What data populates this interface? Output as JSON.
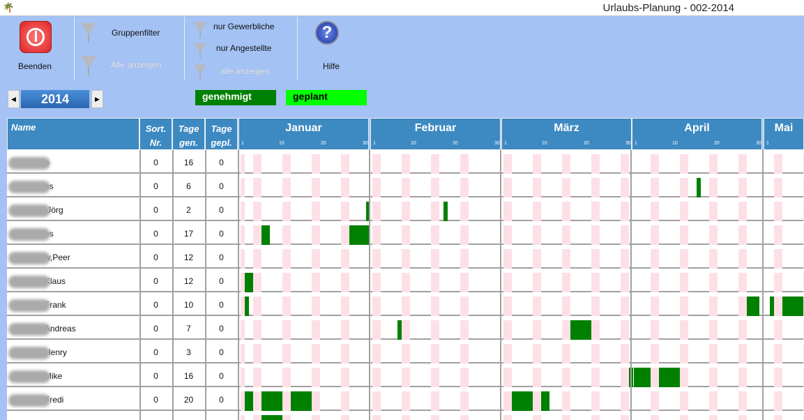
{
  "window": {
    "title": "Urlaubs-Planung - 002-2014"
  },
  "toolbar": {
    "quit": "Beenden",
    "group_filter": "Gruppenfilter",
    "show_all": "Alle anzeigen",
    "only_commercial": "nur Gewerbliche",
    "only_employees": "nur Angestellte",
    "show_all2": "alle anzeigen",
    "help": "Hilfe"
  },
  "year": "2014",
  "legend": {
    "approved": "genehmigt",
    "planned": "geplant",
    "approved_color": "#008000",
    "planned_color": "#00ff00"
  },
  "headers": {
    "name": "Name",
    "sort1": "Sort.",
    "sort2": "Nr.",
    "gen1": "Tage",
    "gen2": "gen.",
    "gepl1": "Tage",
    "gepl2": "gepl."
  },
  "months": [
    "Januar",
    "Februar",
    "März",
    "April",
    "Mai"
  ],
  "ticks": [
    "1",
    "10",
    "20",
    "30"
  ],
  "colors": {
    "weekend": "#fde0e6",
    "header": "#3d89c2",
    "approved": "#008000"
  },
  "rows": [
    {
      "name": "o",
      "sort": "0",
      "gen": "16",
      "gepl": "0",
      "vac": []
    },
    {
      "name": "es",
      "sort": "0",
      "gen": "6",
      "gepl": "0",
      "vac": [
        [
          3,
          16,
          16
        ]
      ]
    },
    {
      "name": ",Jörg",
      "sort": "0",
      "gen": "2",
      "gepl": "0",
      "vac": [
        [
          0,
          31,
          31
        ],
        [
          1,
          18,
          18
        ]
      ]
    },
    {
      "name": "es",
      "sort": "0",
      "gen": "17",
      "gepl": "0",
      "vac": [
        [
          0,
          6,
          7
        ],
        [
          0,
          27,
          31
        ]
      ]
    },
    {
      "name": "w,Peer",
      "sort": "0",
      "gen": "12",
      "gepl": "0",
      "vac": []
    },
    {
      "name": "Klaus",
      "sort": "0",
      "gen": "12",
      "gepl": "0",
      "vac": [
        [
          0,
          2,
          3
        ]
      ]
    },
    {
      "name": "Frank",
      "sort": "0",
      "gen": "10",
      "gepl": "0",
      "vac": [
        [
          0,
          2,
          2
        ],
        [
          3,
          28,
          30
        ],
        [
          4,
          2,
          2
        ],
        [
          4,
          5,
          9
        ]
      ]
    },
    {
      "name": "Andreas",
      "sort": "0",
      "gen": "7",
      "gepl": "0",
      "vac": [
        [
          1,
          7,
          7
        ],
        [
          2,
          17,
          21
        ]
      ]
    },
    {
      "name": "Henry",
      "sort": "0",
      "gen": "3",
      "gepl": "0",
      "vac": []
    },
    {
      "name": "Mike",
      "sort": "0",
      "gen": "16",
      "gepl": "0",
      "vac": [
        [
          2,
          31,
          31
        ],
        [
          3,
          1,
          4
        ],
        [
          3,
          7,
          11
        ]
      ]
    },
    {
      "name": "Fredi",
      "sort": "0",
      "gen": "20",
      "gepl": "0",
      "vac": [
        [
          0,
          2,
          3
        ],
        [
          0,
          6,
          10
        ],
        [
          0,
          13,
          17
        ],
        [
          2,
          3,
          7
        ],
        [
          2,
          10,
          11
        ]
      ]
    },
    {
      "name": "",
      "sort": "",
      "gen": "",
      "gepl": "",
      "vac": [
        [
          0,
          6,
          10
        ]
      ]
    }
  ]
}
